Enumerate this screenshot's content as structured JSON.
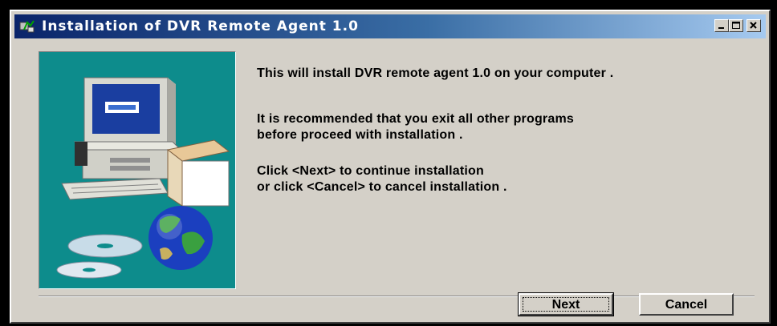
{
  "window": {
    "title": "Installation of DVR Remote Agent 1.0"
  },
  "titlebar_buttons": [
    "minimize-icon",
    "maximize-icon",
    "close-icon"
  ],
  "content": {
    "paragraphs": [
      [
        "This will install DVR remote agent 1.0 on your computer ."
      ],
      [
        "It is recommended that you exit all other programs",
        "before proceed with installation ."
      ],
      [
        "Click <Next> to continue installation",
        "or click <Cancel> to cancel installation ."
      ]
    ]
  },
  "buttons": {
    "next_label": "Next",
    "cancel_label": "Cancel"
  },
  "colors": {
    "titlebar_start": "#0a246a",
    "titlebar_end": "#a6caf0",
    "dialog_face": "#d4d0c8",
    "image_background": "#0d8c8c"
  }
}
